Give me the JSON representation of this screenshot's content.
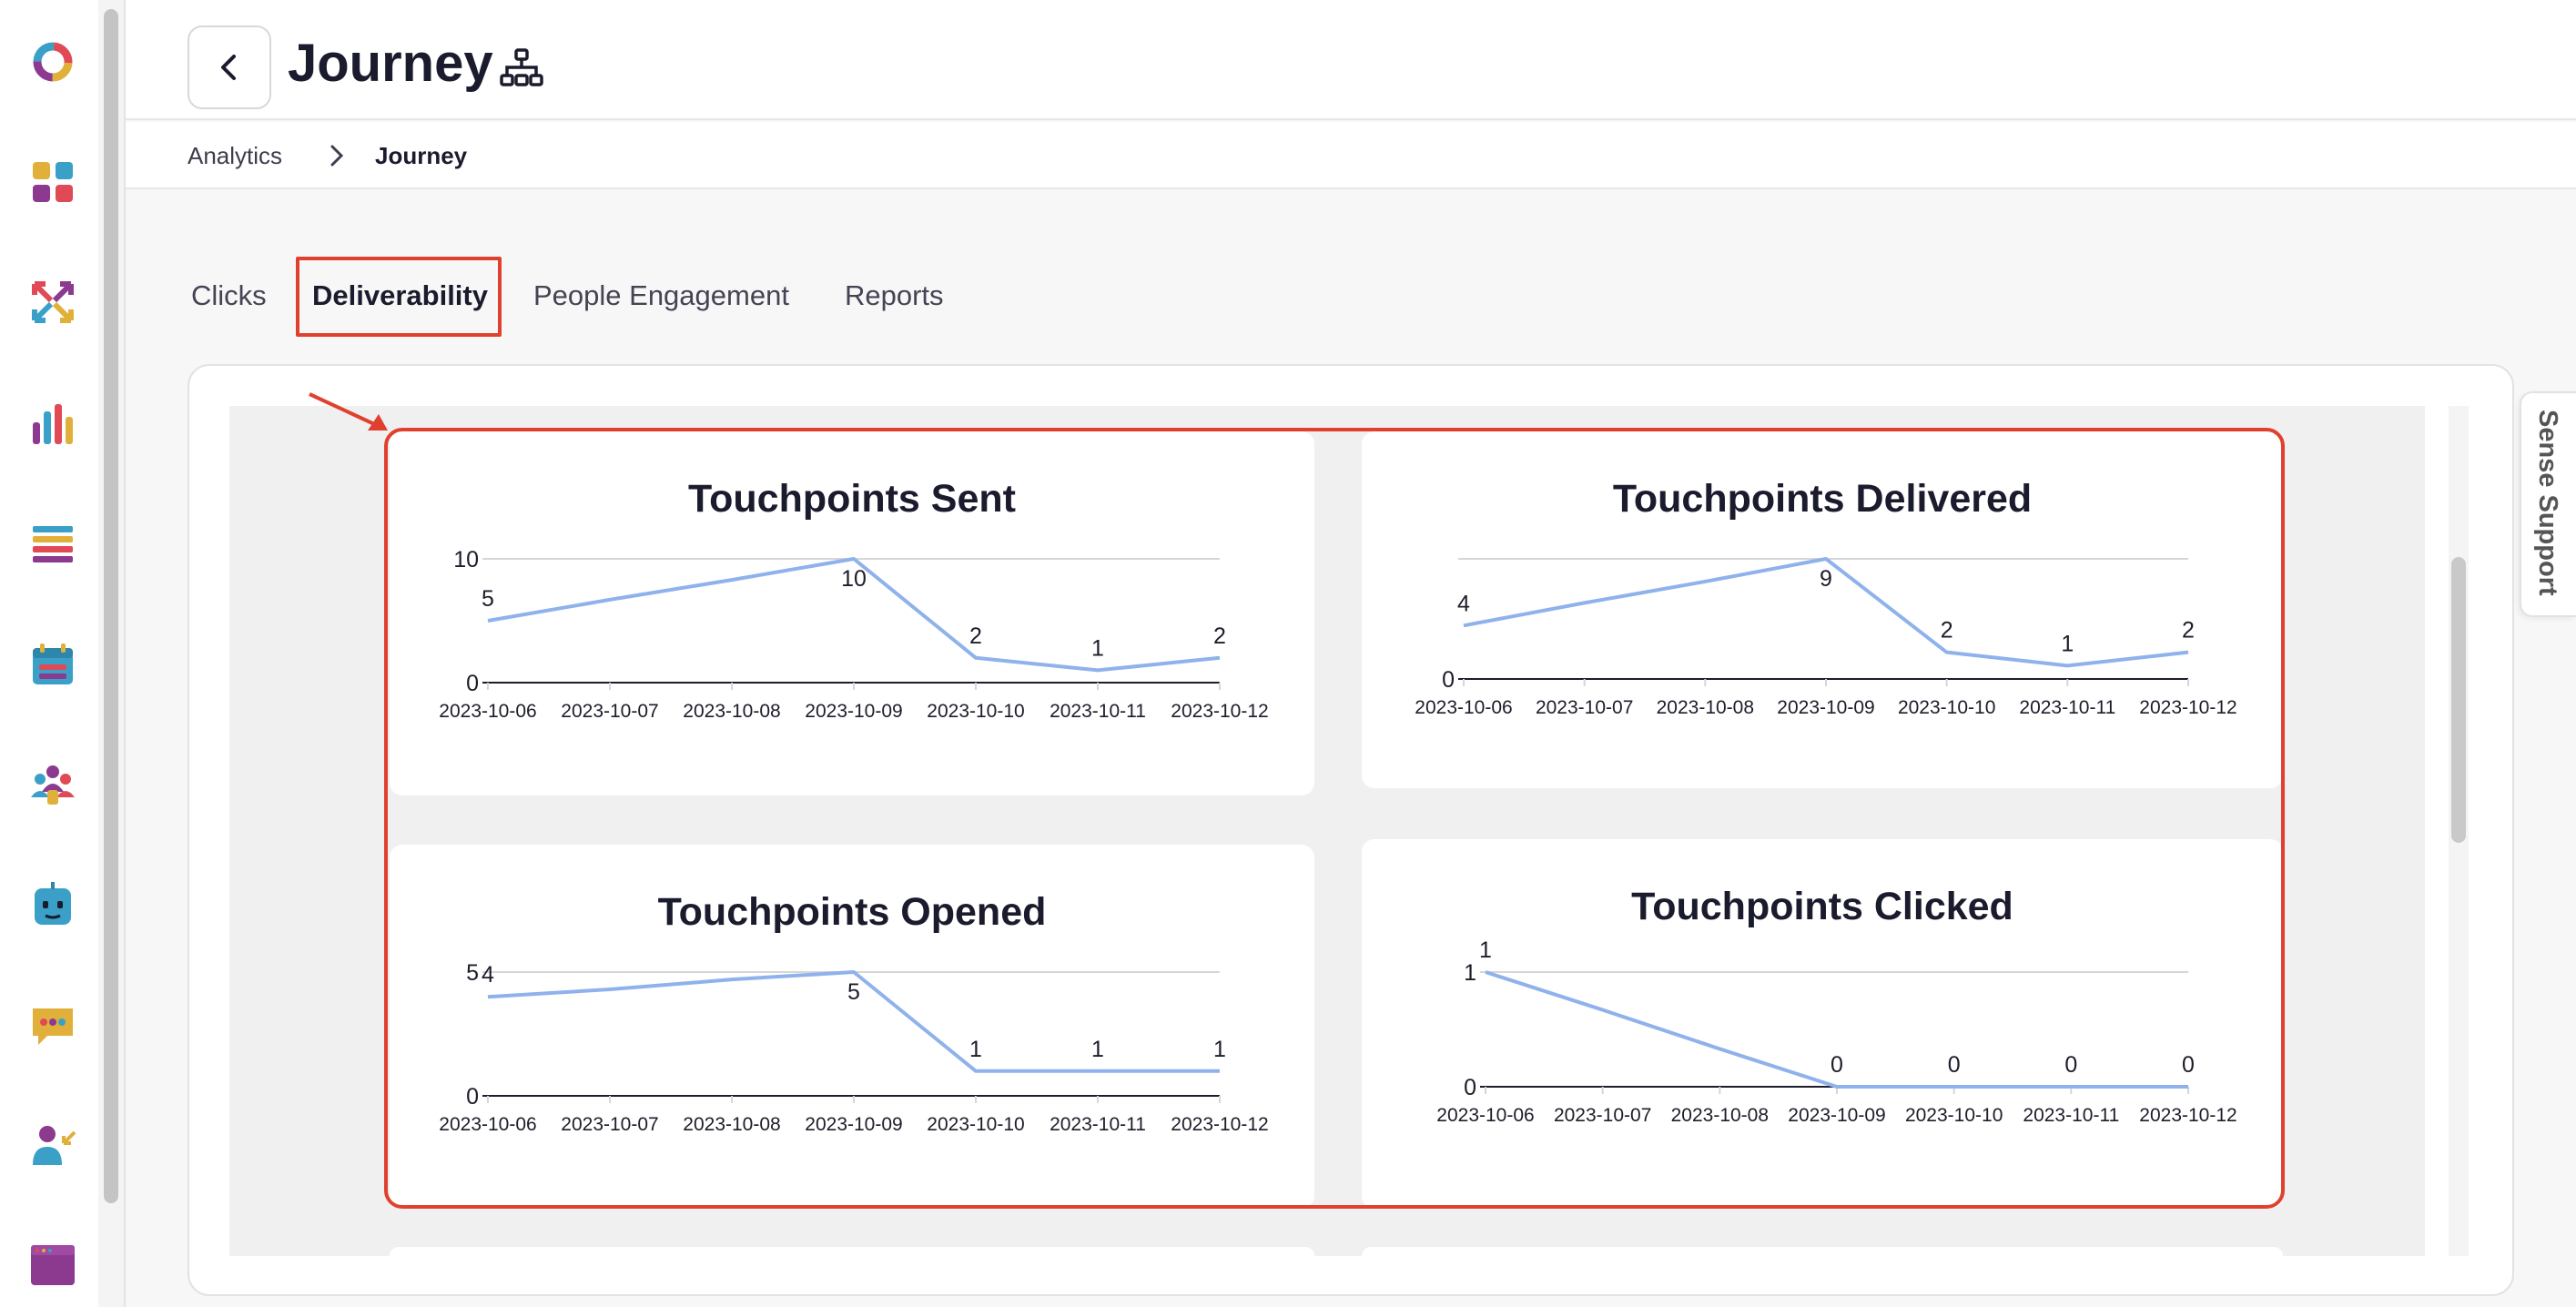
{
  "header": {
    "title": "Journey",
    "back_icon": "chevron-left-icon",
    "title_icon": "sitemap-icon"
  },
  "breadcrumb": {
    "items": [
      "Analytics",
      "Journey"
    ],
    "separator_icon": "chevron-right-icon"
  },
  "tabs": [
    {
      "label": "Clicks",
      "active": false
    },
    {
      "label": "Deliverability",
      "active": true
    },
    {
      "label": "People Engagement",
      "active": false
    },
    {
      "label": "Reports",
      "active": false
    }
  ],
  "sidebar": {
    "icons": [
      "logo-ring-icon",
      "apps-grid-icon",
      "arrows-icon",
      "bar-chart-icon",
      "list-icon",
      "calendar-icon",
      "people-icon",
      "bot-icon",
      "chat-icon",
      "user-assign-icon",
      "browser-window-icon"
    ]
  },
  "support": {
    "label": "Sense Support"
  },
  "colors": {
    "accent": "#e0412f",
    "line": "#8fb2ec",
    "axis": "#1d1d2b",
    "grid": "#d6d6d6"
  },
  "chart_data": [
    {
      "type": "line",
      "title": "Touchpoints Sent",
      "x": [
        "2023-10-06",
        "2023-10-07",
        "2023-10-08",
        "2023-10-09",
        "2023-10-10",
        "2023-10-11",
        "2023-10-12"
      ],
      "values": [
        5,
        6.7,
        8.3,
        10,
        2,
        1,
        2
      ],
      "data_labels": [
        "5",
        "",
        "",
        "10",
        "2",
        "1",
        "2"
      ],
      "y_ticks": [
        "0",
        "10"
      ],
      "ylim": [
        0,
        10
      ]
    },
    {
      "type": "line",
      "title": "Touchpoints Delivered",
      "x": [
        "2023-10-06",
        "2023-10-07",
        "2023-10-08",
        "2023-10-09",
        "2023-10-10",
        "2023-10-11",
        "2023-10-12"
      ],
      "values": [
        4,
        5.7,
        7.3,
        9,
        2,
        1,
        2
      ],
      "data_labels": [
        "4",
        "",
        "",
        "9",
        "2",
        "1",
        "2"
      ],
      "y_ticks": [
        "0"
      ],
      "ylim": [
        0,
        9
      ]
    },
    {
      "type": "line",
      "title": "Touchpoints Opened",
      "x": [
        "2023-10-06",
        "2023-10-07",
        "2023-10-08",
        "2023-10-09",
        "2023-10-10",
        "2023-10-11",
        "2023-10-12"
      ],
      "values": [
        4,
        4.3,
        4.7,
        5,
        1,
        1,
        1
      ],
      "data_labels": [
        "4",
        "",
        "",
        "5",
        "1",
        "1",
        "1"
      ],
      "y_ticks": [
        "0",
        "5"
      ],
      "ylim": [
        0,
        5
      ]
    },
    {
      "type": "line",
      "title": "Touchpoints Clicked",
      "x": [
        "2023-10-06",
        "2023-10-07",
        "2023-10-08",
        "2023-10-09",
        "2023-10-10",
        "2023-10-11",
        "2023-10-12"
      ],
      "values": [
        1,
        0.67,
        0.33,
        0,
        0,
        0,
        0
      ],
      "data_labels": [
        "1",
        "",
        "",
        "0",
        "0",
        "0",
        "0"
      ],
      "y_ticks": [
        "0",
        "1"
      ],
      "ylim": [
        0,
        1
      ]
    }
  ]
}
